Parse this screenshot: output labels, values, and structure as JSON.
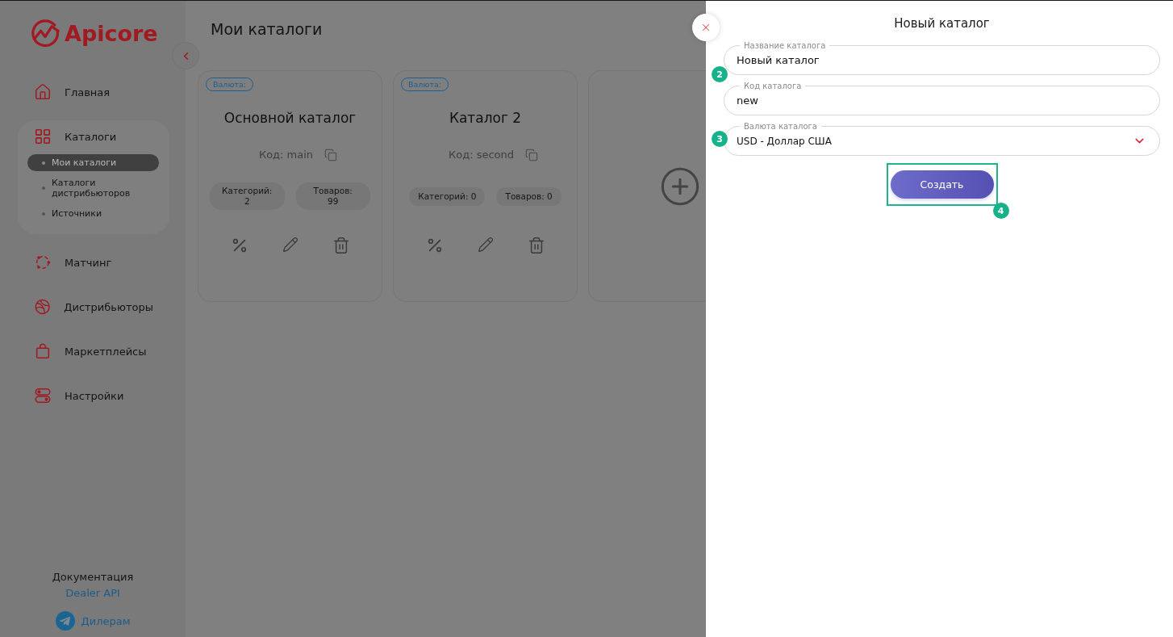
{
  "logo": {
    "text": "Apicore"
  },
  "nav": [
    {
      "kind": "home",
      "label": "Главная",
      "selected": false
    },
    {
      "kind": "catalogs",
      "label": "Каталоги",
      "selected": false,
      "expanded": true,
      "children": [
        {
          "label": "Мои каталоги",
          "selected": true
        },
        {
          "label": "Каталоги дистрибьюторов",
          "selected": false
        },
        {
          "label": "Источники",
          "selected": false
        }
      ]
    },
    {
      "kind": "matching",
      "label": "Матчинг",
      "selected": false
    },
    {
      "kind": "distributors",
      "label": "Дистрибьюторы",
      "selected": false
    },
    {
      "kind": "marketplaces",
      "label": "Маркетплейсы",
      "selected": false
    },
    {
      "kind": "settings",
      "label": "Настройки",
      "selected": false
    }
  ],
  "footer": {
    "docs_title": "Документация",
    "docs_link": "Dealer API",
    "telegram_link": "Дилерам"
  },
  "page": {
    "title": "Мои каталоги"
  },
  "catalogs": [
    {
      "kind": "catalog",
      "badge": "Валюта:",
      "title": "Основной каталог",
      "code": "Код: main",
      "stats_stacked": true,
      "stats": [
        "Категорий: 2",
        "Товаров: 99"
      ]
    },
    {
      "kind": "catalog",
      "badge": "Валюта:",
      "title": "Каталог 2",
      "code": "Код: second",
      "stats_stacked": false,
      "stats": [
        "Категорий: 0",
        "Товаров: 0"
      ]
    },
    {
      "kind": "add"
    }
  ],
  "drawer": {
    "title": "Новый каталог",
    "fields": [
      {
        "kind": "text",
        "label": "Название каталога",
        "value": "Новый каталог",
        "marker": "2"
      },
      {
        "kind": "text",
        "label": "Код каталога",
        "value": "new"
      },
      {
        "kind": "select",
        "label": "Валюта каталога",
        "value": "USD - Доллар США",
        "marker": "3"
      }
    ],
    "submit": {
      "label": "Создать",
      "highlighted": true,
      "marker": "4"
    }
  }
}
